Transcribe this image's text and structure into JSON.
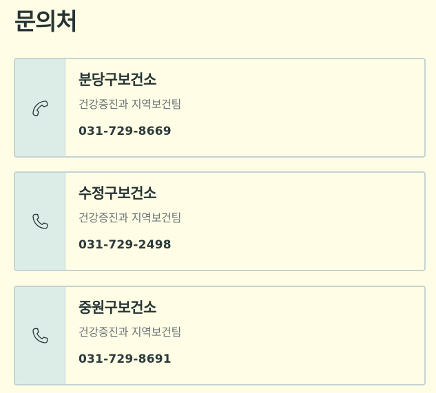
{
  "page": {
    "title": "문의처"
  },
  "contacts": [
    {
      "name": "분당구보건소",
      "department": "건강증진과 지역보건팀",
      "phone": "031-729-8669",
      "icon": "phone-icon"
    },
    {
      "name": "수정구보건소",
      "department": "건강증진과 지역보건팀",
      "phone": "031-729-2498",
      "icon": "phone-icon"
    },
    {
      "name": "중원구보건소",
      "department": "건강증진과 지역보건팀",
      "phone": "031-729-8691",
      "icon": "phone-icon"
    }
  ],
  "colors": {
    "background": "#fffde6",
    "icon_panel": "#dcede8",
    "border": "#c4d4d2",
    "text_primary": "#263434",
    "text_secondary": "#6b7575"
  }
}
